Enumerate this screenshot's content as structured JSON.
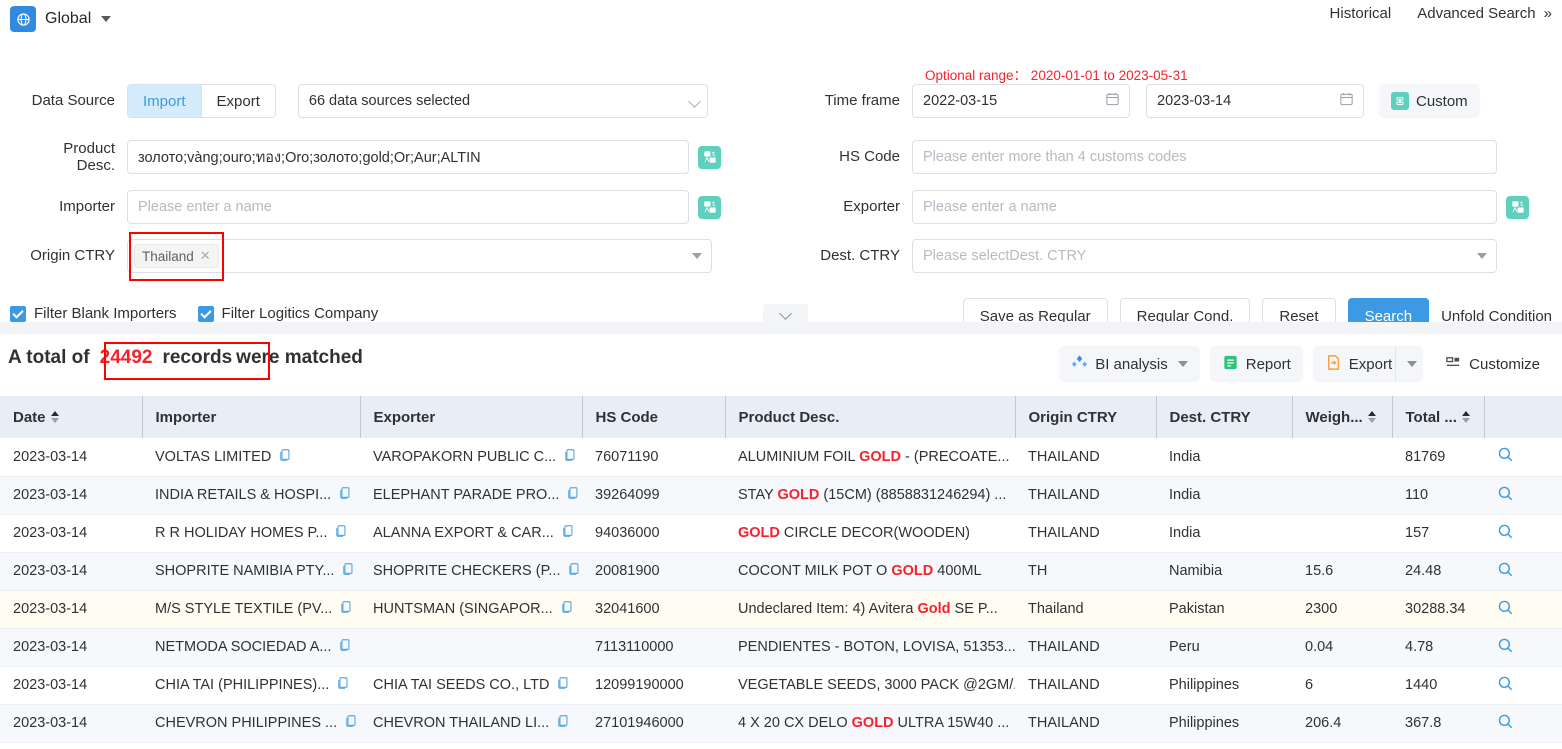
{
  "topbar": {
    "globe_label": "Global",
    "historical": "Historical",
    "advanced_search": "Advanced Search",
    "advanced_chevron": "»"
  },
  "search": {
    "data_source_label": "Data Source",
    "import_label": "Import",
    "export_label": "Export",
    "sources_value": "66 data sources selected",
    "product_desc_label_1": "Product",
    "product_desc_label_2": "Desc.",
    "product_desc_value": "золото;vàng;ouro;ทอง;Oro;золото;gold;Or;Aur;ALTIN",
    "importer_label": "Importer",
    "importer_placeholder": "Please enter a name",
    "origin_ctry_label": "Origin CTRY",
    "origin_ctry_tag": "Thailand",
    "time_frame_label": "Time frame",
    "optional_range": "Optional range： 2020-01-01 to 2023-05-31",
    "date_from": "2022-03-15",
    "date_to": "2023-03-14",
    "custom_label": "Custom",
    "hs_code_label": "HS Code",
    "hs_code_placeholder": "Please enter more than 4 customs codes",
    "exporter_label": "Exporter",
    "exporter_placeholder": "Please enter a name",
    "dest_ctry_label": "Dest. CTRY",
    "dest_ctry_placeholder": "Please selectDest. CTRY",
    "filter_blank_importers": "Filter Blank Importers",
    "filter_logistics_company": "Filter Logitics Company",
    "save_as_regular": "Save as Regular",
    "regular_cond": "Regular Cond.",
    "reset": "Reset",
    "search": "Search",
    "unfold_condition": "Unfold Condition"
  },
  "results": {
    "total_prefix": "A total of",
    "total_count": "24492",
    "records_word": "records",
    "total_suffix": "were matched",
    "bi_analysis": "BI analysis",
    "report": "Report",
    "export": "Export",
    "customize": "Customize"
  },
  "table": {
    "columns": [
      {
        "label": "Date",
        "sortable": true
      },
      {
        "label": "Importer",
        "sortable": false
      },
      {
        "label": "Exporter",
        "sortable": false
      },
      {
        "label": "HS Code",
        "sortable": false
      },
      {
        "label": "Product Desc.",
        "sortable": false
      },
      {
        "label": "Origin CTRY",
        "sortable": false
      },
      {
        "label": "Dest. CTRY",
        "sortable": false
      },
      {
        "label": "Weigh...",
        "sortable": true
      },
      {
        "label": "Total ...",
        "sortable": true
      }
    ],
    "rows": [
      {
        "date": "2023-03-14",
        "importer": "VOLTAS LIMITED",
        "exporter": "VAROPAKORN PUBLIC C...",
        "hs_code": "76071190",
        "product_desc": "ALUMINIUM FOIL GOLD - (PRECOATE...",
        "product_highlight": "GOLD",
        "origin_ctry": "THAILAND",
        "dest_ctry": "India",
        "weight": "",
        "total": "81769",
        "highlight_row": false
      },
      {
        "date": "2023-03-14",
        "importer": "INDIA RETAILS & HOSPI...",
        "exporter": "ELEPHANT PARADE PRO...",
        "hs_code": "39264099",
        "product_desc": "STAY GOLD (15CM) (8858831246294) ...",
        "product_highlight": "GOLD",
        "origin_ctry": "THAILAND",
        "dest_ctry": "India",
        "weight": "",
        "total": "110",
        "highlight_row": false
      },
      {
        "date": "2023-03-14",
        "importer": "R R HOLIDAY HOMES P...",
        "exporter": "ALANNA EXPORT & CAR...",
        "hs_code": "94036000",
        "product_desc": "GOLD CIRCLE DECOR(WOODEN)",
        "product_highlight": "GOLD",
        "origin_ctry": "THAILAND",
        "dest_ctry": "India",
        "weight": "",
        "total": "157",
        "highlight_row": false
      },
      {
        "date": "2023-03-14",
        "importer": "SHOPRITE NAMIBIA PTY...",
        "exporter": "SHOPRITE CHECKERS (P...",
        "hs_code": "20081900",
        "product_desc": "COCONT MILK POT O GOLD 400ML",
        "product_highlight": "GOLD",
        "origin_ctry": "TH",
        "dest_ctry": "Namibia",
        "weight": "15.6",
        "total": "24.48",
        "highlight_row": false
      },
      {
        "date": "2023-03-14",
        "importer": "M/S STYLE TEXTILE (PV...",
        "exporter": "HUNTSMAN (SINGAPOR...",
        "hs_code": "32041600",
        "product_desc": "Undeclared Item: 4) Avitera Gold SE P...",
        "product_highlight": "Gold",
        "origin_ctry": "Thailand",
        "dest_ctry": "Pakistan",
        "weight": "2300",
        "total": "30288.34",
        "highlight_row": true
      },
      {
        "date": "2023-03-14",
        "importer": "NETMODA SOCIEDAD A...",
        "exporter": "",
        "hs_code": "7113110000",
        "product_desc": "PENDIENTES - BOTON, LOVISA, 51353...",
        "product_highlight": "",
        "origin_ctry": "THAILAND",
        "dest_ctry": "Peru",
        "weight": "0.04",
        "total": "4.78",
        "highlight_row": false
      },
      {
        "date": "2023-03-14",
        "importer": "CHIA TAI (PHILIPPINES)...",
        "exporter": "CHIA TAI SEEDS CO., LTD",
        "hs_code": "12099190000",
        "product_desc": "VEGETABLE SEEDS, 3000 PACK @2GM/...",
        "product_highlight": "",
        "origin_ctry": "THAILAND",
        "dest_ctry": "Philippines",
        "weight": "6",
        "total": "1440",
        "highlight_row": false
      },
      {
        "date": "2023-03-14",
        "importer": "CHEVRON PHILIPPINES ...",
        "exporter": "CHEVRON THAILAND LI...",
        "hs_code": "27101946000",
        "product_desc": "4 X 20 CX DELO GOLD ULTRA 15W40 ...",
        "product_highlight": "GOLD",
        "origin_ctry": "THAILAND",
        "dest_ctry": "Philippines",
        "weight": "206.4",
        "total": "367.8",
        "highlight_row": false
      }
    ]
  },
  "colors": {
    "accent": "#3b9ae3",
    "danger": "#f5222d",
    "teal": "#5fd0bd",
    "header_bg": "#e9eef6"
  }
}
